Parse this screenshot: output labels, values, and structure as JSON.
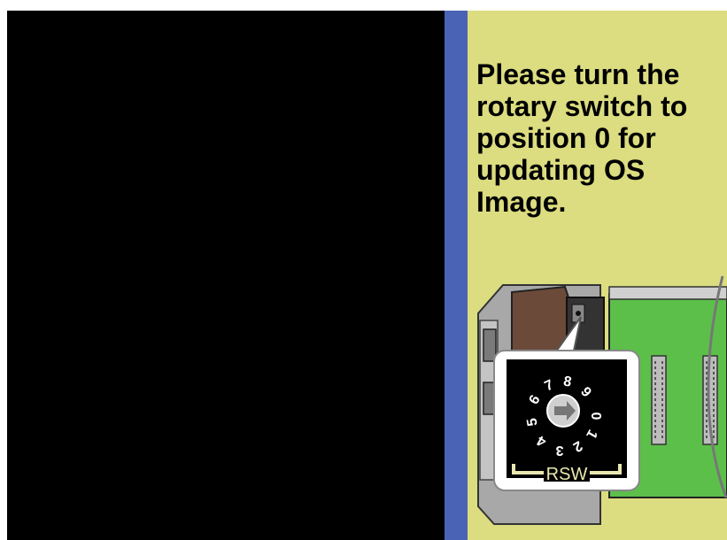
{
  "instruction": {
    "text": "Please turn the rotary switch to position 0 for updating OS Image."
  },
  "rotary_switch": {
    "label": "RSW",
    "digits": [
      "0",
      "1",
      "2",
      "3",
      "4",
      "5",
      "6",
      "7",
      "8",
      "9"
    ]
  },
  "colors": {
    "screen": "#000000",
    "divider": "#4a63b5",
    "panel": "#dcdc80",
    "board": "#5cbf4a"
  }
}
